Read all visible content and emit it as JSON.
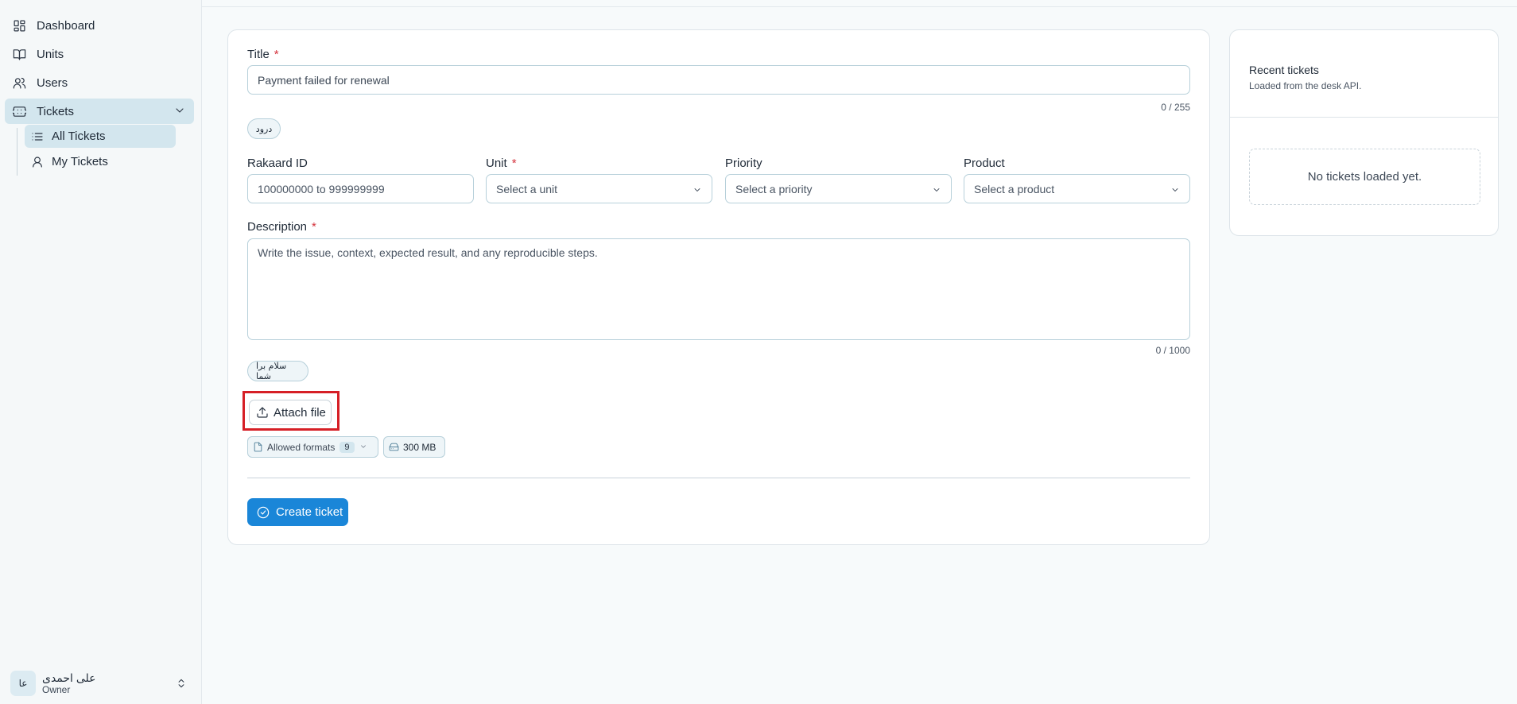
{
  "sidebar": {
    "items": [
      {
        "label": "Dashboard",
        "icon": "dashboard-icon"
      },
      {
        "label": "Units",
        "icon": "book-icon"
      },
      {
        "label": "Users",
        "icon": "users-icon"
      },
      {
        "label": "Tickets",
        "icon": "ticket-icon",
        "expanded": true
      }
    ],
    "sub_items": [
      {
        "label": "All Tickets",
        "icon": "list-icon",
        "active": true
      },
      {
        "label": "My Tickets",
        "icon": "user-icon"
      }
    ],
    "user": {
      "initials": "عا",
      "name": "علی احمدی",
      "role": "Owner"
    }
  },
  "form": {
    "title_label": "Title",
    "title_value": "Payment failed for renewal",
    "title_counter": "0 / 255",
    "title_chip": "درود",
    "rakaard_label": "Rakaard ID",
    "rakaard_placeholder": "100000000 to 999999999",
    "unit_label": "Unit",
    "unit_placeholder": "Select a unit",
    "priority_label": "Priority",
    "priority_placeholder": "Select a priority",
    "product_label": "Product",
    "product_placeholder": "Select a product",
    "description_label": "Description",
    "description_placeholder": "Write the issue, context, expected result, and any reproducible steps.",
    "description_counter": "0 / 1000",
    "description_chip": "سلام برا شما",
    "attach_label": "Attach file",
    "allowed_formats_label": "Allowed formats",
    "allowed_formats_count": "9",
    "max_size": "300 MB",
    "create_label": "Create ticket",
    "required_mark": "*"
  },
  "recent": {
    "title": "Recent tickets",
    "subtitle": "Loaded from the desk API.",
    "empty": "No tickets loaded yet."
  },
  "colors": {
    "accent": "#1a86d8",
    "active_bg": "#d3e6ee",
    "required": "#d4323c",
    "highlight": "#d61f26"
  }
}
